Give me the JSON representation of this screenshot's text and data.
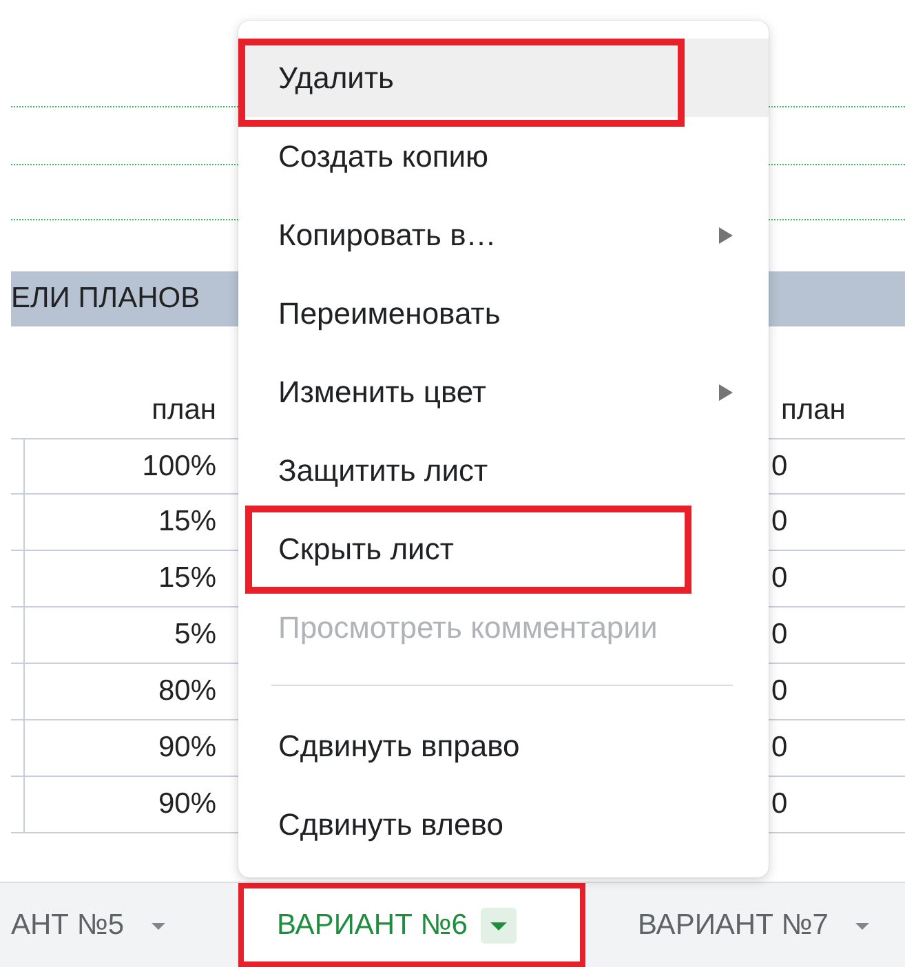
{
  "sheet": {
    "band_text": "ЕЛИ ПЛАНОВ",
    "columns": [
      {
        "header": "план",
        "values": [
          "100%",
          "15%",
          "15%",
          "5%",
          "80%",
          "90%",
          "90%"
        ]
      },
      {
        "header": "план",
        "values": [
          "0",
          "0",
          "0",
          "0",
          "0",
          "0",
          "0"
        ]
      }
    ]
  },
  "context_menu": {
    "items": [
      {
        "kind": "item",
        "label": "Удалить",
        "hovered": true,
        "highlighted": true,
        "has_submenu": false,
        "disabled": false
      },
      {
        "kind": "item",
        "label": "Создать копию",
        "hovered": false,
        "highlighted": false,
        "has_submenu": false,
        "disabled": false
      },
      {
        "kind": "item",
        "label": "Копировать в…",
        "hovered": false,
        "highlighted": false,
        "has_submenu": true,
        "disabled": false
      },
      {
        "kind": "item",
        "label": "Переименовать",
        "hovered": false,
        "highlighted": false,
        "has_submenu": false,
        "disabled": false
      },
      {
        "kind": "item",
        "label": "Изменить цвет",
        "hovered": false,
        "highlighted": false,
        "has_submenu": true,
        "disabled": false
      },
      {
        "kind": "item",
        "label": "Защитить лист",
        "hovered": false,
        "highlighted": false,
        "has_submenu": false,
        "disabled": false
      },
      {
        "kind": "item",
        "label": "Скрыть лист",
        "hovered": false,
        "highlighted": true,
        "has_submenu": false,
        "disabled": false
      },
      {
        "kind": "item",
        "label": "Просмотреть комментарии",
        "hovered": false,
        "highlighted": false,
        "has_submenu": false,
        "disabled": true
      },
      {
        "kind": "divider"
      },
      {
        "kind": "item",
        "label": "Сдвинуть вправо",
        "hovered": false,
        "highlighted": false,
        "has_submenu": false,
        "disabled": false
      },
      {
        "kind": "item",
        "label": "Сдвинуть влево",
        "hovered": false,
        "highlighted": false,
        "has_submenu": false,
        "disabled": false
      }
    ]
  },
  "sheet_tabs": [
    {
      "label": "АНТ №5",
      "selected": false,
      "highlighted": false
    },
    {
      "label": "ВАРИАНТ №6",
      "selected": true,
      "highlighted": true
    },
    {
      "label": "ВАРИАНТ №7",
      "selected": false,
      "highlighted": false
    }
  ]
}
